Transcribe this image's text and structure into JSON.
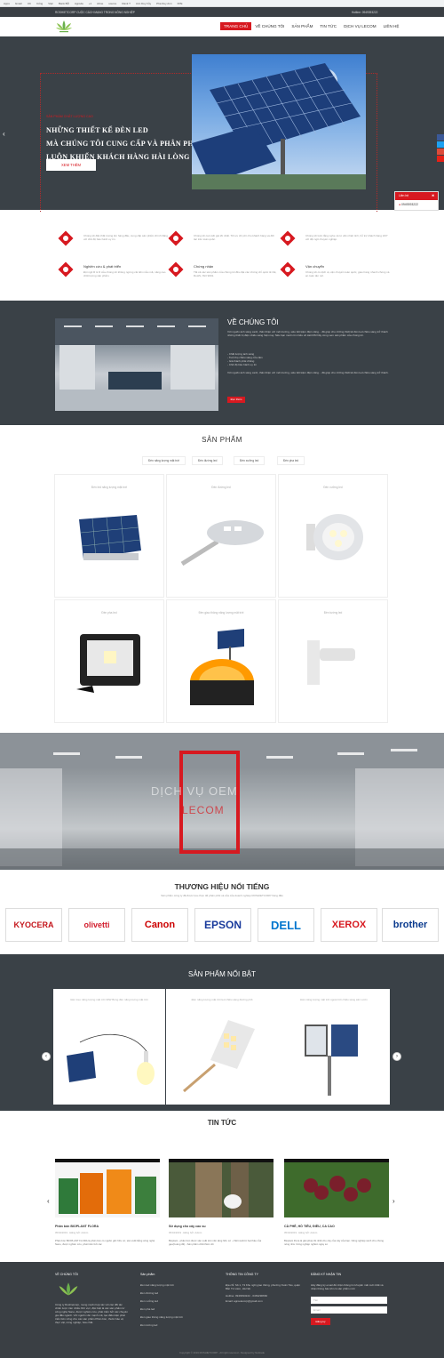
{
  "browser": {
    "tabs": [
      "Apps",
      "Gmail",
      "UC",
      "Cổng",
      "Việc",
      "Bank BỘ",
      "Agroda",
      "",
      "+1",
      "shine",
      "source",
      "Rank T",
      "Ann Duy hủy",
      "Pha Duy Ann",
      "FPE",
      ""
    ]
  },
  "topbar": {
    "left": "ROSHIETCORP CUỘC CÁCH MẠNG TRONG NÔNG NGHIỆP",
    "right": "Hotline: 0949393222"
  },
  "nav": {
    "items": [
      "TRANG CHỦ",
      "VỀ CHÚNG TÔI",
      "SẢN PHẨM",
      "TIN TỨC",
      "DỊCH VỤ LECOM",
      "LIÊN HỆ"
    ]
  },
  "hero": {
    "subtitle": "SẢN PHẨM CHẤT LƯỢNG CAO",
    "line1": "NHỮNG THIẾT KẾ ĐÈN LED",
    "line2": "MÀ CHÚNG TÔI CUNG CẤP VÀ PHÂN PHỐI",
    "line3": "LUÔN KHIẾN KHÁCH HÀNG HÀI LÒNG",
    "button": "XEM THÊM",
    "prev": "‹"
  },
  "contact_widget": {
    "title": "Liên hệ",
    "close": "✖",
    "phone": "0949393222"
  },
  "features": [
    {
      "title": "",
      "desc": "Chúng tôi đặt chất lượng lên hàng đầu, cung cấp sản phẩm chính hãng với chế độ bảo hành uy tín."
    },
    {
      "title": "",
      "desc": "Chúng tôi cam kết giá tốt nhất. Tối ưu chi phí cho khách hàng và đối tác trên toàn quốc."
    },
    {
      "title": "",
      "desc": "Chúng tôi luôn lắng nghe và tư vấn nhiệt tình, hỗ trợ khách hàng 24/7 với đội ngũ chuyên nghiệp."
    },
    {
      "title": "Nghiên cứu & phát triển",
      "desc": "Đội ngũ R & D của chúng tôi không ngừng cải tiến mẫu mã, nâng cao chất lượng sản phẩm."
    },
    {
      "title": "Chứng nhận",
      "desc": "Tất cả các sản phẩm của chúng tôi đều đạt các chứng chỉ quốc tế CE, RoHS, ISO 9001."
    },
    {
      "title": "Vận chuyển",
      "desc": "Chúng tôi có dịch vụ vận chuyển toàn quốc, giao hàng nhanh chóng và an toàn tận nơi."
    }
  ],
  "about": {
    "heading": "VỀ CHÚNG TÔI",
    "p1": "Với nguồn ánh sáng xanh, thân thiện với môi trường, siêu tiết kiệm điện năng... đã giúp cho những thiết kế đèn led chiếu sáng trở thành những thiết bị điện chiếu sáng hiện nay. Nếu bạn muốn tìm hiểu về LECOM hãy cùng xem sản phẩm của chúng tôi.",
    "b1": "- Chất lượng ánh sáng",
    "b2": "- Tuổi thọ chiếu sáng cửa đèn",
    "b3": "- Giá thành phải chăng",
    "b4": "- Chế độ bảo hành uy tín",
    "p2": "Với nguồn ánh sáng xanh, thân thiện với môi trường, siêu tiết kiệm điện năng... đã giúp cho những thiết kế đèn led chiếu sáng trở thành.",
    "button": "Đọc thêm"
  },
  "products": {
    "heading": "SẢN PHẨM",
    "tabs": [
      "Đèn năng lượng mặt trời",
      "Đèn đường led",
      "Đèn xưởng led",
      "Đèn pha led"
    ],
    "cards": [
      "Đèn led năng lượng mặt trời",
      "Đèn đường led",
      "Đèn xưởng led",
      "Đèn pha led",
      "Đèn giao thông năng lượng mặt trời",
      "Đèn tường led"
    ]
  },
  "oem": {
    "title": "DỊCH VỤ OEM",
    "sub": "LECOM"
  },
  "brands": {
    "heading": "THƯƠNG HIỆU NỔI TIẾNG",
    "sub": "Sản phẩm công ty đã được lựa chọn để phân phối và của của doanh nghiệp ROSHIETCORP hàng đầu",
    "items": [
      "KYOCERA",
      "olivetti",
      "Canon",
      "EPSON",
      "DELL",
      "XEROX",
      "brother"
    ]
  },
  "featured": {
    "heading": "SẢN PHẨM NỔI BẬT",
    "cards": [
      "Đèn treo năng lượng mặt trời 30W Bóng đèn năng lượng mặt trời",
      "Đèn năng lượng mặt trời led chiếu sáng đường phố",
      "Đèn năng lượng mặt trời ngoài trời chiếu sáng sân vườn"
    ],
    "prev": "‹",
    "next": "›"
  },
  "news": {
    "heading": "TIN TỨC",
    "items": [
      {
        "title": "Phân bón BIOPLANT FLORA",
        "meta": "05/04/2019 · Đăng bởi: Admin",
        "desc": "Phân bón BIOPLANT FLORA là phân bón có nguồn gốc hữu cơ, sản xuất bằng công nghệ Nano, được nghiên cứu, phát triển bởi các"
      },
      {
        "title": "Sử dụng cho cây cao su",
        "meta": "05/04/2019 · Đăng bởi: Admin",
        "desc": "Bioplant - phân bón được sản xuất trên nền tảng hữu cơ - chiết xuất từ hạt thảo của gạo(hoàng đế) - Sản phẩm chất thiên nhi"
      },
      {
        "title": "CÀ PHÊ, HỒ TIÊU, ĐIỀU, CA CAO",
        "meta": "05/04/2019 · Đăng bởi: Admin",
        "desc": "Bioplant Flora là giải pháp tốt nhất cho cây của cây của bạn. Nông nghiệp xanh cho chúng nông nhà: Công nghiệp nghiên ngày sư"
      }
    ],
    "prev": "‹",
    "next": "›"
  },
  "footer": {
    "col1_title": "VỀ CHÚNG TÔI",
    "col1_text": "Công ty Roshietcorp, mong muốn hợp tác với các đối tác chiến lược trên nhiều lĩnh vực, đặc biệt là các sản phẩm từ công nghệ Nano, được nghiên cứu, phát triển bởi các chuyên gia đầu ngành. Với nguồn vốn mạnh mẽ, tạo điều kiện phát triển bền vững cho các sản phẩm Phân bón, thuốc bảo vệ thực vật, nông nghiệp, hóa chất.",
    "col2_title": "Sản phẩm",
    "col2_links": [
      "Đèn led năng lượng mặt trời",
      "Đèn đường led",
      "Đèn xưởng led",
      "Đèn pha led",
      "Đèn giao thông năng lượng mặt trời",
      "Đèn tường led"
    ],
    "col3_title": "THÔNG TIN CÔNG TY",
    "col3_lines": [
      "Địa chỉ: Số 1, 73 Khu nghị giao thông, phường Xuân Tảo, quận Bắc Từ Liêm, Hà Nội",
      "Hotline: 0949393222 - 0463290660",
      "Email: agroelecorp@gmail.com"
    ],
    "col4_title": "ĐĂNG KÝ NHẬN TIN",
    "col4_text": "Hãy đăng ký email để nhận thông tin khuyến mãi mới nhất và nhận thông báo khi có sản phẩm mới",
    "placeholder1": "Tên",
    "placeholder2": "Email",
    "button": "Đăng ký",
    "copyright": "Copyright © 2019 ROSHIETCORP - All right reserved - Designed by Nettrade"
  }
}
